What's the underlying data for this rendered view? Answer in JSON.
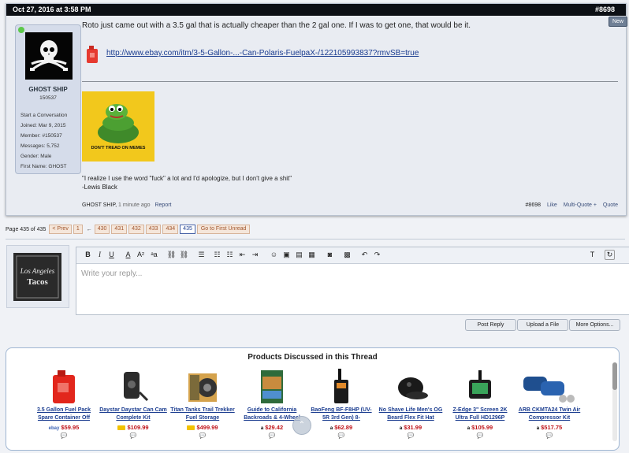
{
  "post": {
    "date": "Oct 27, 2016 at 3:58 PM",
    "number": "#8698",
    "new_badge": "New",
    "message": "Roto just came out with a 3.5 gal that is actually cheaper than the 2 gal one. If I was to get one, that would be it.",
    "link": "http://www.ebay.com/itm/3-5-Gallon-...-Can-Polaris-FuelpaX-/122105993837?rmvSB=true",
    "meme_caption": "DON'T TREAD ON MEMES",
    "signature": [
      "\"I realize I use the word \"fuck\" a lot and I'd apologize, but I don't give a shit\"",
      "-Lewis Black"
    ],
    "footer": {
      "author": "GHOST SHIP,",
      "time": "1 minute ago",
      "report": "Report",
      "post_num": "#8698",
      "like": "Like",
      "multi_quote": "Multi-Quote +",
      "quote": "Quote"
    }
  },
  "user": {
    "name": "GHOST SHIP",
    "id": "150537",
    "info": [
      "Start a Conversation",
      "Joined: Mar 9, 2015",
      "Member: #150537",
      "Messages: 5,752",
      "Gender: Male",
      "First Name: GHOST"
    ]
  },
  "pagenav": {
    "label": "Page 435 of 435",
    "prev": "< Prev",
    "first": "1",
    "ellipsis": "←",
    "pages": [
      "430",
      "431",
      "432",
      "433",
      "434",
      "435"
    ],
    "current": "435",
    "go_first_unread": "Go to First Unread"
  },
  "reply": {
    "avatar_text": [
      "Los Angeles",
      "Tacos"
    ],
    "placeholder": "Write your reply...",
    "post_reply": "Post Reply",
    "upload_file": "Upload a File",
    "more_options": "More Options..."
  },
  "toolbar": {
    "bold": "B",
    "italic": "I",
    "underline": "U",
    "font_color": "A",
    "font_size": "A²",
    "font_family": "ᵃa"
  },
  "products": {
    "title": "Products Discussed in this Thread",
    "items": [
      {
        "name": "3.5 Gallon Fuel Pack Spare Container Off",
        "price": "$59.95",
        "store": "ebay",
        "icon": "gas-can-icon"
      },
      {
        "name": "Daystar Daystar Can Cam Complete Kit",
        "price": "$109.99",
        "store": "prime",
        "icon": "can-cam-icon"
      },
      {
        "name": "Titan Tanks Trail Trekker Fuel Storage",
        "price": "$499.99",
        "store": "prime",
        "icon": "fuel-tank-icon"
      },
      {
        "name": "Guide to California Backroads & 4-Wheel",
        "price": "$29.42",
        "store": "amazon",
        "icon": "book-icon"
      },
      {
        "name": "BaoFeng BF-F8HP (UV-5R 3rd Gen) 8-",
        "price": "$62.89",
        "store": "amazon",
        "icon": "radio-icon"
      },
      {
        "name": "No Shave Life Men's OG Beard Flex Fit Hat",
        "price": "$31.99",
        "store": "amazon",
        "icon": "hat-icon"
      },
      {
        "name": "Z-Edge 3\" Screen 2K Ultra Full HD1296P",
        "price": "$105.99",
        "store": "amazon",
        "icon": "dashcam-icon"
      },
      {
        "name": "ARB CKMTA24 Twin Air Compressor Kit",
        "price": "$517.75",
        "store": "amazon",
        "icon": "compressor-icon"
      }
    ]
  },
  "colors": {
    "header_bg": "#0d1015",
    "link": "#1b3d90",
    "price": "#c0141a",
    "page_btn": "#f5e6da"
  }
}
